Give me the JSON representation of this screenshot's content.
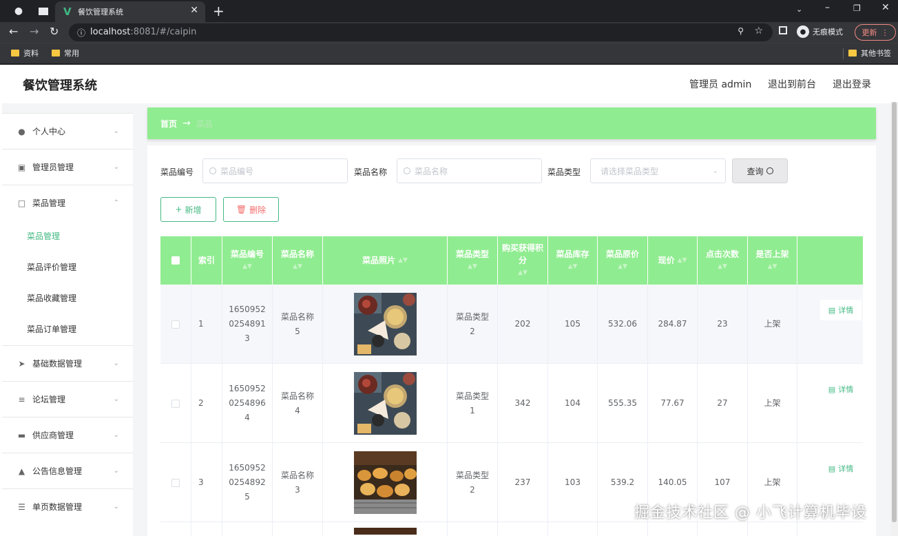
{
  "browser": {
    "tab_title": "餐饮管理系统",
    "url_host": "localhost",
    "url_rest": ":8081/#/caipin",
    "incognito_label": "无痕模式",
    "update_label": "更新",
    "bookmarks": [
      "资料",
      "常用"
    ],
    "other_bookmarks": "其他书签"
  },
  "app": {
    "title": "餐饮管理系统",
    "user_label": "管理员 admin",
    "to_front": "退出到前台",
    "logout": "退出登录"
  },
  "sidebar": {
    "menus": [
      {
        "label": "个人中心",
        "icon": "user-icon"
      },
      {
        "label": "管理员管理",
        "icon": "admin-icon"
      },
      {
        "label": "菜品管理",
        "icon": "chat-icon",
        "expanded": true
      },
      {
        "label": "基础数据管理",
        "icon": "send-icon"
      },
      {
        "label": "论坛管理",
        "icon": "sliders-icon"
      },
      {
        "label": "供应商管理",
        "icon": "monitor-icon"
      },
      {
        "label": "公告信息管理",
        "icon": "megaphone-icon"
      },
      {
        "label": "单页数据管理",
        "icon": "list-icon"
      }
    ],
    "submenu": [
      "菜品管理",
      "菜品评价管理",
      "菜品收藏管理",
      "菜品订单管理"
    ],
    "active_submenu": "菜品管理"
  },
  "breadcrumb": {
    "home": "首页",
    "current": "菜品"
  },
  "search": {
    "code_label": "菜品编号",
    "code_placeholder": "菜品编号",
    "name_label": "菜品名称",
    "name_placeholder": "菜品名称",
    "type_label": "菜品类型",
    "type_placeholder": "请选择菜品类型",
    "query_label": "查询"
  },
  "actions": {
    "add": "新增",
    "delete": "删除"
  },
  "table": {
    "columns": [
      "索引",
      "菜品编号",
      "菜品名称",
      "菜品照片",
      "菜品类型",
      "购买获得积分",
      "菜品库存",
      "菜品原价",
      "现价",
      "点击次数",
      "是否上架"
    ],
    "detail_label": "详情",
    "rows": [
      {
        "index": "1",
        "code": "16509520254891 3",
        "code_lines": [
          "1650952",
          "0254891",
          "3"
        ],
        "name_lines": [
          "菜品名称",
          "5"
        ],
        "type_lines": [
          "菜品类型",
          "2"
        ],
        "points": "202",
        "stock": "105",
        "original": "532.06",
        "price": "284.87",
        "clicks": "23",
        "status": "上架",
        "photo": "platter"
      },
      {
        "index": "2",
        "code_lines": [
          "1650952",
          "0254896",
          "4"
        ],
        "name_lines": [
          "菜品名称",
          "4"
        ],
        "type_lines": [
          "菜品类型",
          "1"
        ],
        "points": "342",
        "stock": "104",
        "original": "555.35",
        "price": "77.67",
        "clicks": "27",
        "status": "上架",
        "photo": "platter"
      },
      {
        "index": "3",
        "code_lines": [
          "1650952",
          "0254892",
          "5"
        ],
        "name_lines": [
          "菜品名称",
          "3"
        ],
        "type_lines": [
          "菜品类型",
          "2"
        ],
        "points": "237",
        "stock": "103",
        "original": "539.2",
        "price": "140.05",
        "clicks": "107",
        "status": "上架",
        "photo": "skewers"
      }
    ]
  },
  "watermark": "掘金技术社区 @ 小飞计算机毕设",
  "colors": {
    "accent": "#42b983",
    "header_green": "#90ec90",
    "danger": "#f56c6c"
  }
}
